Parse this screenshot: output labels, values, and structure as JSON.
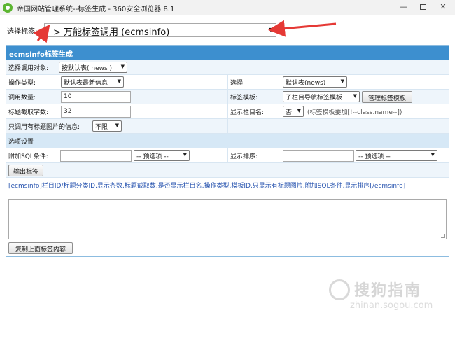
{
  "window": {
    "title": "帝国网站管理系统--标签生成 - 360安全浏览器 8.1",
    "minimize": "—",
    "close": "✕"
  },
  "tag_select": {
    "label": "选择标签:",
    "value": "> 万能标签调用 (ecmsinfo)"
  },
  "panel": {
    "header": "ecmsinfo标签生成",
    "call_target": {
      "label": "选择调用对象:",
      "value": "按默认表( news )"
    },
    "op_type": {
      "label": "操作类型:",
      "value": "默认表最新信息"
    },
    "choose": {
      "label": "选择:",
      "value": "默认表(news)"
    },
    "count": {
      "label": "调用数量:",
      "value": "10"
    },
    "template": {
      "label": "标签模板:",
      "value": "子栏目导航标签模板",
      "manage_button": "管理标签模板"
    },
    "title_len": {
      "label": "标题截取字数:",
      "value": "32"
    },
    "show_class": {
      "label": "显示栏目名:",
      "value": "否",
      "hint": "(标签模板要加[!--class.name--])"
    },
    "only_pic": {
      "label": "只调用有标题图片的信息:",
      "value": "不限"
    },
    "options_section": "选项设置",
    "sql": {
      "label": "附加SQL条件:",
      "value": "",
      "preset": "-- 预选项 --"
    },
    "order": {
      "label": "显示排序:",
      "value": "",
      "preset": "-- 预选项 --"
    },
    "output_button": "输出标签",
    "syntax": "[ecmsinfo]栏目ID/标题分类ID,显示条数,标题截取数,是否显示栏目名,操作类型,模板ID,只显示有标题图片,附加SQL条件,显示排序[/ecmsinfo]",
    "output_value": "",
    "copy_button": "复制上面标签内容"
  },
  "watermark": {
    "text": "搜狗指南",
    "sub": "zhinan.sogou.com"
  },
  "colors": {
    "header": "#3d8fcf",
    "annotation_arrow": "#e53935"
  }
}
